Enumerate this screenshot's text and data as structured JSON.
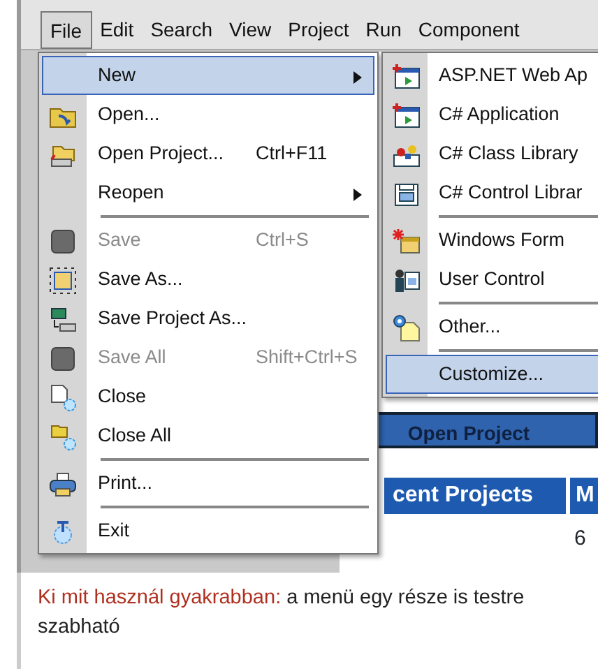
{
  "menu_bar": [
    {
      "label": "File",
      "selected": true
    },
    {
      "label": "Edit",
      "selected": false
    },
    {
      "label": "Search",
      "selected": false
    },
    {
      "label": "View",
      "selected": false
    },
    {
      "label": "Project",
      "selected": false
    },
    {
      "label": "Run",
      "selected": false
    },
    {
      "label": "Component",
      "selected": false
    }
  ],
  "file_menu": [
    {
      "kind": "item",
      "label": "New",
      "submenu": true,
      "selected": true,
      "disabled": false
    },
    {
      "kind": "item",
      "label": "Open...",
      "selected": false,
      "disabled": false
    },
    {
      "kind": "item",
      "label": "Open Project...",
      "shortcut": "Ctrl+F11",
      "selected": false,
      "disabled": false
    },
    {
      "kind": "item",
      "label": "Reopen",
      "submenu": true,
      "selected": false,
      "disabled": false
    },
    {
      "kind": "separator"
    },
    {
      "kind": "item",
      "label": "Save",
      "shortcut": "Ctrl+S",
      "selected": false,
      "disabled": true
    },
    {
      "kind": "item",
      "label": "Save As...",
      "selected": false,
      "disabled": false
    },
    {
      "kind": "item",
      "label": "Save Project As...",
      "selected": false,
      "disabled": false
    },
    {
      "kind": "item",
      "label": "Save All",
      "shortcut": "Shift+Ctrl+S",
      "selected": false,
      "disabled": true
    },
    {
      "kind": "item",
      "label": "Close",
      "selected": false,
      "disabled": false
    },
    {
      "kind": "item",
      "label": "Close All",
      "selected": false,
      "disabled": false
    },
    {
      "kind": "separator"
    },
    {
      "kind": "item",
      "label": "Print...",
      "selected": false,
      "disabled": false
    },
    {
      "kind": "separator"
    },
    {
      "kind": "item",
      "label": "Exit",
      "selected": false,
      "disabled": false
    }
  ],
  "new_submenu": [
    {
      "kind": "item",
      "label": "ASP.NET Web Ap",
      "selected": false
    },
    {
      "kind": "item",
      "label": "C# Application",
      "selected": false
    },
    {
      "kind": "item",
      "label": "C# Class Library",
      "selected": false
    },
    {
      "kind": "item",
      "label": "C# Control Librar",
      "selected": false
    },
    {
      "kind": "separator"
    },
    {
      "kind": "item",
      "label": "Windows Form",
      "selected": false
    },
    {
      "kind": "item",
      "label": "User Control",
      "selected": false
    },
    {
      "kind": "separator"
    },
    {
      "kind": "item",
      "label": "Other...",
      "selected": false
    },
    {
      "kind": "separator"
    },
    {
      "kind": "item",
      "label": "Customize...",
      "selected": true
    }
  ],
  "welcome_page": {
    "open_project": "Open Project",
    "recent_header": "cent Projects",
    "column_header": "M",
    "cell": "6"
  },
  "caption": "**Ki mit használ gyakrabban:** a menü egy része is testre szabható"
}
